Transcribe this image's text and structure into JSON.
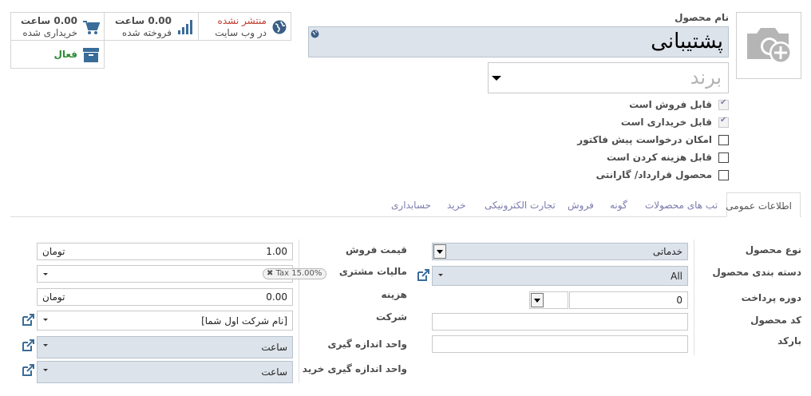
{
  "stats": {
    "website": {
      "status": "منتشر نشده",
      "label": "در وب سایت",
      "icon": "globe-icon",
      "status_color": "#c0392b"
    },
    "sold": {
      "value": "0.00 ساعت",
      "label": "فروخته شده",
      "icon": "bar-chart-icon"
    },
    "purchased": {
      "value": "0.00 ساعت",
      "label": "خریداری شده",
      "icon": "shopping-cart-icon"
    },
    "active": {
      "label": "فعال",
      "icon": "archive-icon",
      "color": "#2d8a34"
    }
  },
  "product": {
    "name_label": "نام محصول",
    "name": "پشتیبانی",
    "brand_placeholder": "برند",
    "image_icon": "camera-plus-icon"
  },
  "checkboxes": [
    {
      "label": "قابل فروش است",
      "checked": true
    },
    {
      "label": "قابل خریداری است",
      "checked": true
    },
    {
      "label": "امکان درخواست پیش فاکتور",
      "checked": false
    },
    {
      "label": "قابل هزینه کردن است",
      "checked": false
    },
    {
      "label": "محصول قرارداد/ گارانتی",
      "checked": false
    }
  ],
  "tabs": [
    {
      "label": "اطلاعات عمومی",
      "active": true
    },
    {
      "label": "تب های محصولات"
    },
    {
      "label": "گونه"
    },
    {
      "label": "فروش"
    },
    {
      "label": "تجارت الکترونیکی"
    },
    {
      "label": "خرید"
    },
    {
      "label": "حسابداری"
    }
  ],
  "general": {
    "right": {
      "product_type_label": "نوع محصول",
      "product_type_value": "خدماتی",
      "category_label": "دسته بندی محصول",
      "category_value": "All",
      "payment_period_label": "دوره پرداخت",
      "payment_period_value": "0",
      "product_code_label": "کد محصول",
      "product_code_value": "",
      "barcode_label": "بارکد",
      "barcode_value": ""
    },
    "left": {
      "sale_price_label": "قیمت فروش",
      "sale_price_value": "1.00",
      "sale_price_currency": "تومان",
      "customer_taxes_label": "مالیات مشتری",
      "customer_tax_tag": "Tax 15.00%",
      "cost_label": "هزینه",
      "cost_value": "0.00",
      "cost_currency": "تومان",
      "company_label": "شرکت",
      "company_value": "[نام شرکت اول شما]",
      "uom_label": "واحد اندازه گیری",
      "uom_value": "ساعت",
      "purchase_uom_label": "واحد اندازه گیری خرید",
      "purchase_uom_value": "ساعت"
    }
  },
  "colors": {
    "link": "#7c7bad",
    "required_bg": "#dde3ea",
    "icon_blue": "#3a6c99"
  }
}
